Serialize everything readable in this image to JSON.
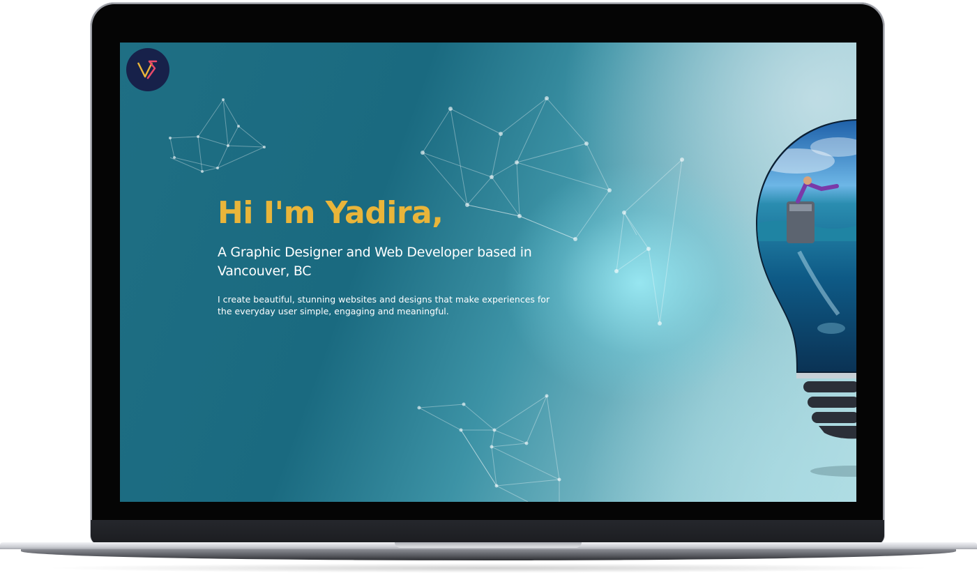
{
  "logo": {
    "icon": "vs-monogram-logo-icon",
    "background": "#17214a",
    "accent": "#e9b53a"
  },
  "hero": {
    "title": "Hi I'm Yadira,",
    "subtitle": "A Graphic Designer and Web Developer based in Vancouver, BC",
    "text": "I create beautiful, stunning websites and designs that make experiences for the everyday user simple, engaging and meaningful."
  },
  "colors": {
    "title": "#e9b53a",
    "background_dark": "#1a6a80",
    "background_light": "#b9dde2"
  },
  "decor": {
    "network": "polygon-network-lines-icon",
    "lightbulb": "lightbulb-ocean-illustration-icon"
  }
}
